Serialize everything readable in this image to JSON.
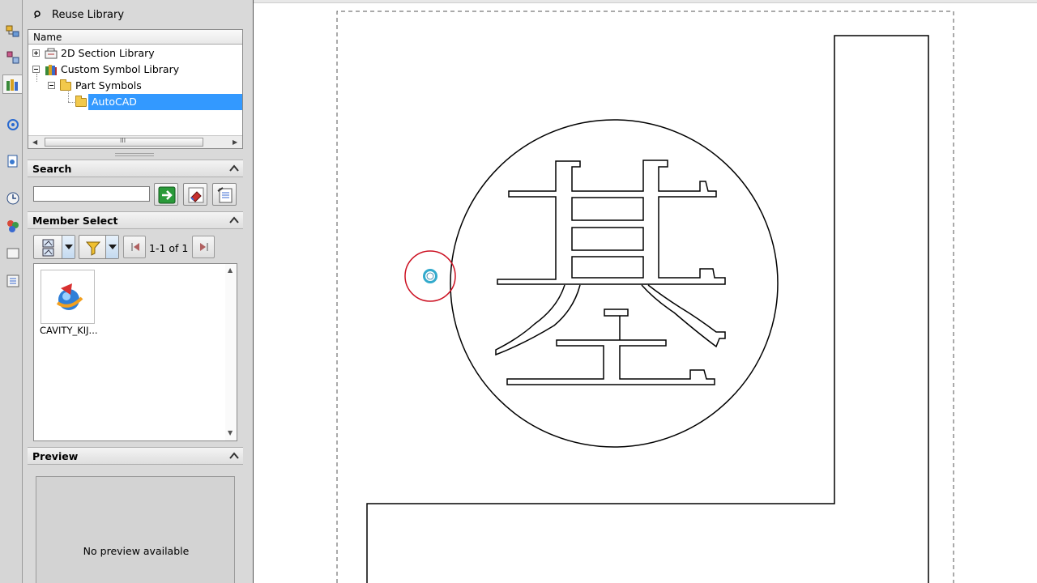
{
  "panel": {
    "title": "Reuse Library"
  },
  "tree": {
    "column_header": "Name",
    "items": [
      {
        "label": "2D Section Library",
        "expanded": false,
        "level": 0
      },
      {
        "label": "Custom Symbol Library",
        "expanded": true,
        "level": 0
      },
      {
        "label": "Part Symbols",
        "expanded": true,
        "level": 1
      },
      {
        "label": "AutoCAD",
        "selected": true,
        "level": 2
      }
    ],
    "scroll_grip": "III"
  },
  "search": {
    "header": "Search",
    "input_value": "",
    "input_placeholder": ""
  },
  "member_select": {
    "header": "Member Select",
    "page_indicator": "1-1 of 1",
    "members": [
      {
        "label": "CAVITY_KIJ..."
      }
    ]
  },
  "preview": {
    "header": "Preview",
    "empty_text": "No preview available"
  },
  "colors": {
    "selection": "#3399ff",
    "panel_bg": "#d9d9d9",
    "cursor_ring": "#cc1122",
    "cursor_dot": "#33aacc"
  }
}
